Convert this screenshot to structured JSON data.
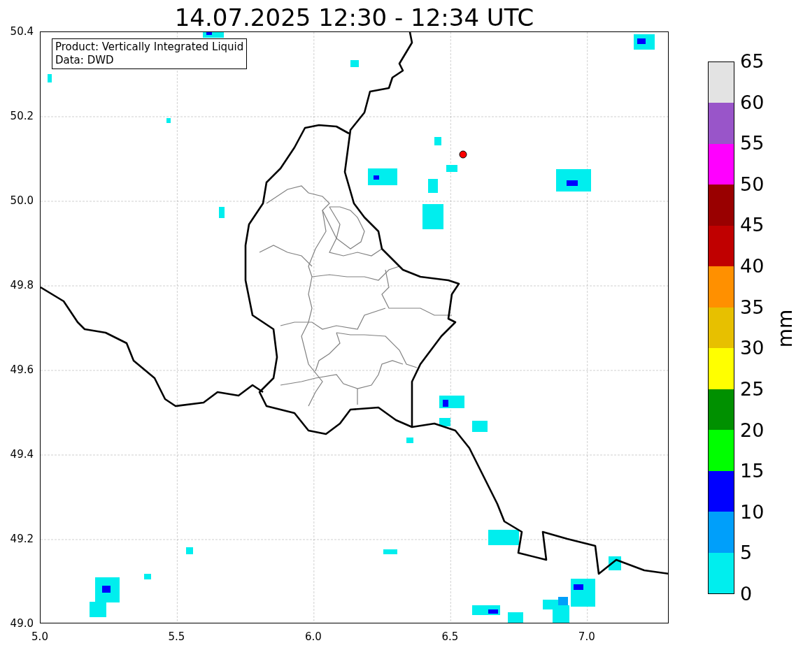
{
  "title": "14.07.2025 12:30 - 12:34 UTC",
  "info_box": [
    "Product: Vertically Integrated Liquid",
    "Data: DWD"
  ],
  "x_ticks": [
    "5.0",
    "5.5",
    "6.0",
    "6.5",
    "7.0"
  ],
  "y_ticks": [
    "50.4",
    "50.2",
    "50.0",
    "49.8",
    "49.6",
    "49.4",
    "49.2",
    "49.0"
  ],
  "colorbar": {
    "label": "mm",
    "ticks": [
      "65",
      "60",
      "55",
      "50",
      "45",
      "40",
      "35",
      "30",
      "25",
      "20",
      "15",
      "10",
      "5",
      "0"
    ],
    "bands": [
      {
        "color": "#e3e3e3"
      },
      {
        "color": "#9955c9"
      },
      {
        "color": "#ff00ff"
      },
      {
        "color": "#990000"
      },
      {
        "color": "#c00000"
      },
      {
        "color": "#ff9000"
      },
      {
        "color": "#e7c000"
      },
      {
        "color": "#ffff00"
      },
      {
        "color": "#009000"
      },
      {
        "color": "#00ff00"
      },
      {
        "color": "#0000ff"
      },
      {
        "color": "#009ffa"
      },
      {
        "color": "#00eeee"
      }
    ]
  }
}
